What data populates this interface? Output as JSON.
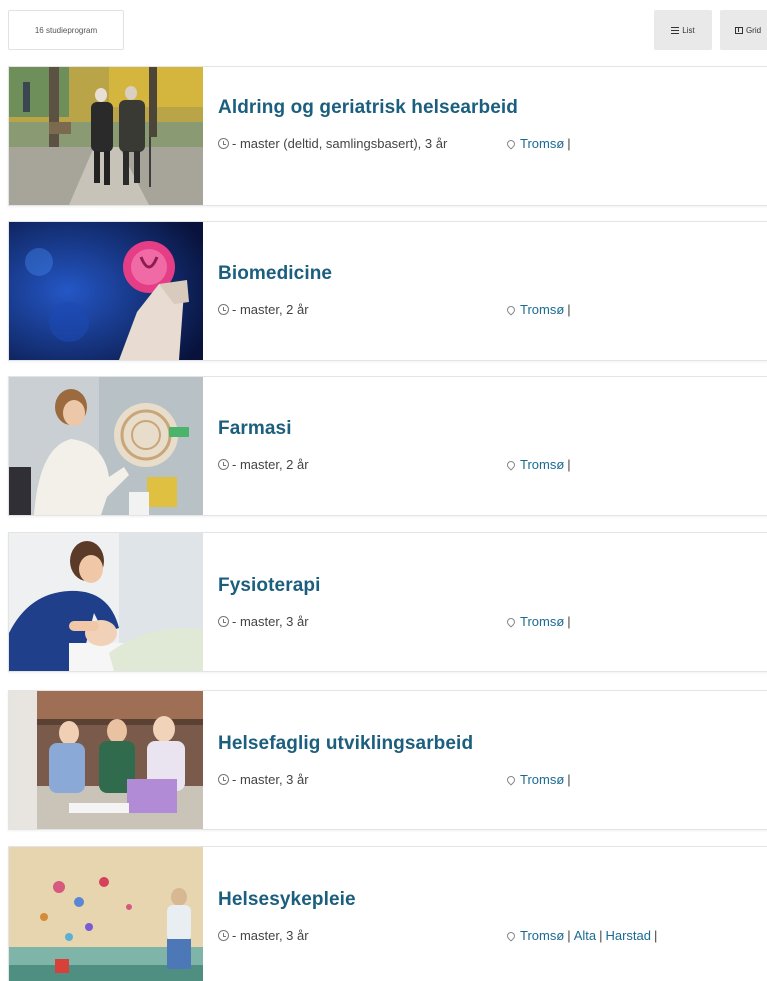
{
  "toolbar": {
    "result_count": "16 studieprogram",
    "list_label": "List",
    "grid_label": "Grid",
    "list_icon": "list-icon",
    "grid_icon": "grid-icon"
  },
  "programs": [
    {
      "title": "Aldring og geriatrisk helsearbeid",
      "meta": "- master (deltid, samlingsbasert), 3 år",
      "locations": [
        "Tromsø"
      ],
      "image": "elderly-couple-walking-photo"
    },
    {
      "title": "Biomedicine",
      "meta": "- master, 2 år",
      "locations": [
        "Tromsø"
      ],
      "image": "petri-dish-lab-photo"
    },
    {
      "title": "Farmasi",
      "meta": "- master, 2 år",
      "locations": [
        "Tromsø"
      ],
      "image": "pharmacy-student-photo"
    },
    {
      "title": "Fysioterapi",
      "meta": "- master, 3 år",
      "locations": [
        "Tromsø"
      ],
      "image": "physiotherapy-photo"
    },
    {
      "title": "Helsefaglig utviklingsarbeid",
      "meta": "- master, 3 år",
      "locations": [
        "Tromsø"
      ],
      "image": "students-group-photo"
    },
    {
      "title": "Helsesykepleie",
      "meta": "- master, 3 år",
      "locations": [
        "Tromsø",
        "Alta",
        "Harstad"
      ],
      "image": "child-painting-wall-photo"
    }
  ],
  "colors": {
    "title": "#1b5e7e",
    "link": "#1b6a93"
  }
}
